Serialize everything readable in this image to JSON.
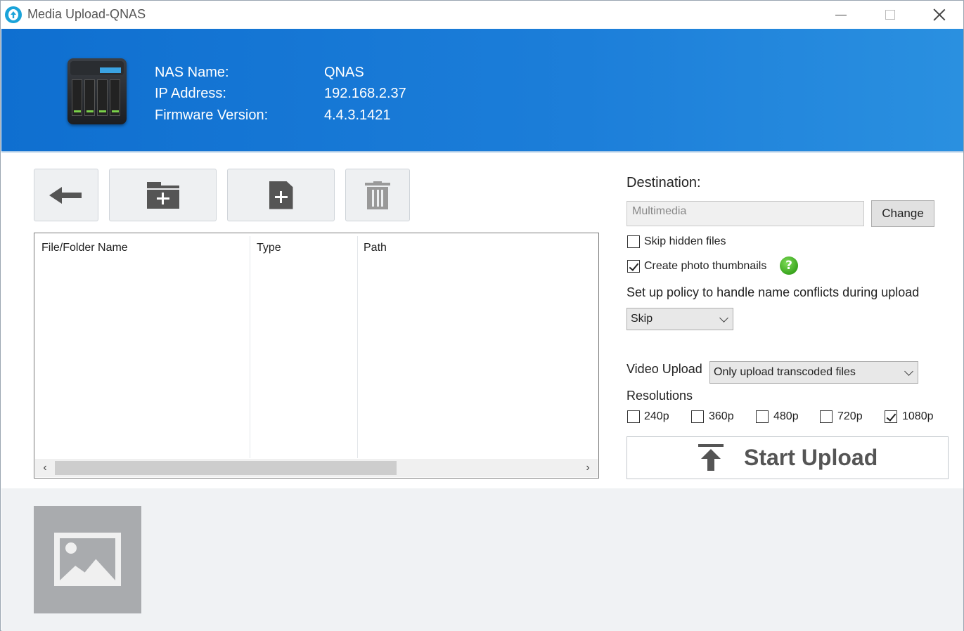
{
  "window": {
    "title": "Media Upload-QNAS"
  },
  "header": {
    "nas_name_label": "NAS Name:",
    "nas_name_value": "QNAS",
    "ip_label": "IP Address:",
    "ip_value": "192.168.2.37",
    "firmware_label": "Firmware Version:",
    "firmware_value": "4.4.3.1421"
  },
  "toolbar": {
    "buttons": [
      {
        "name": "back",
        "icon": "arrow-left-icon"
      },
      {
        "name": "add-folder",
        "icon": "folder-plus-icon"
      },
      {
        "name": "add-file",
        "icon": "file-plus-icon"
      },
      {
        "name": "delete",
        "icon": "trash-icon"
      }
    ]
  },
  "file_list": {
    "columns": [
      "File/Folder Name",
      "Type",
      "Path"
    ],
    "rows": []
  },
  "destination": {
    "label": "Destination:",
    "value": "Multimedia",
    "change_label": "Change"
  },
  "options": {
    "skip_hidden_label": "Skip hidden files",
    "skip_hidden_checked": false,
    "thumbnails_label": "Create photo thumbnails",
    "thumbnails_checked": true,
    "help_glyph": "?",
    "conflict_label": "Set up policy to handle name conflicts during upload",
    "conflict_value": "Skip",
    "video_upload_label": "Video Upload",
    "video_upload_value": "Only upload transcoded files",
    "resolutions_label": "Resolutions",
    "resolutions": [
      {
        "label": "240p",
        "checked": false
      },
      {
        "label": "360p",
        "checked": false
      },
      {
        "label": "480p",
        "checked": false
      },
      {
        "label": "720p",
        "checked": false
      },
      {
        "label": "1080p",
        "checked": true
      }
    ]
  },
  "start_upload": {
    "label": "Start Upload"
  },
  "colors": {
    "header_blue": "#1c7ed9",
    "help_green": "#3aa51e"
  }
}
